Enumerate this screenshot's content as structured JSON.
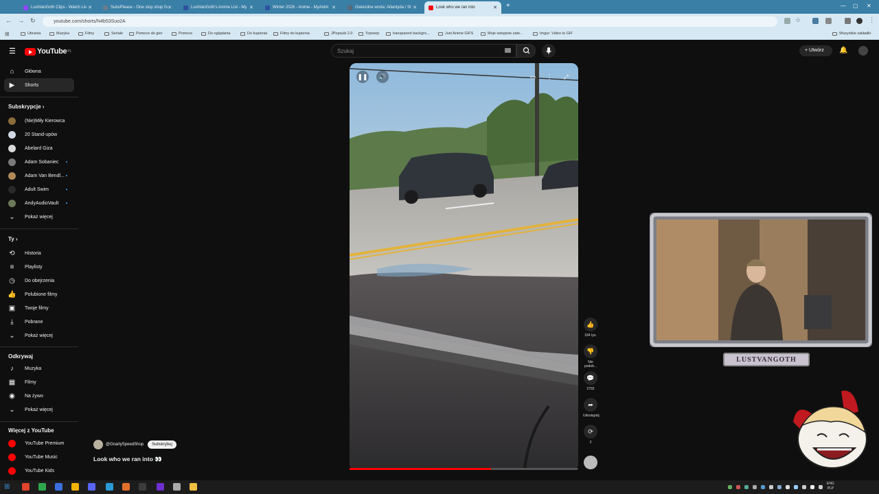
{
  "browser": {
    "tabs": [
      {
        "label": "LustVanGoth Clips - Watch Liv",
        "color": "#9146ff"
      },
      {
        "label": "SubsPlease - One stop shop fo",
        "color": "#6b7c8c"
      },
      {
        "label": "LustVanGoth's Anime List - My",
        "color": "#2e51a2"
      },
      {
        "label": "Winter 2026 - Anime - MyAnim",
        "color": "#2e51a2"
      },
      {
        "label": "Gwiezdne wrota: Atlantyda / St",
        "color": "#5a6a78"
      },
      {
        "label": "Look who we ran into",
        "color": "#ff0000"
      }
    ],
    "new_tab": "+",
    "url": "youtube.com/shorts/N4b53Suo2A",
    "bookmarks": [
      "Ubrania",
      "Muzyka",
      "Filmy",
      "Seriale",
      "Pomoce do gier",
      "Pomoce",
      "Do oglądania",
      "Do kupienia",
      "Filmy do kupienia",
      "JPopsuki 2.0",
      "Trpeeep",
      "transparent backgro...",
      "Just Anime GIFS",
      "Moje wstępnie zate...",
      "Imgur: Video to GIF"
    ],
    "all_bookmarks": "Wszystkie zakładki"
  },
  "youtube": {
    "logo_text": "YouTube",
    "logo_region": "PL",
    "search_placeholder": "Szukaj",
    "create_label": "Utwórz",
    "nav": [
      {
        "label": "Główna",
        "icon": "home-icon"
      },
      {
        "label": "Shorts",
        "icon": "shorts-icon"
      }
    ],
    "subscriptions_header": "Subskrypcje",
    "subscriptions": [
      {
        "label": "(Nie)Miły Kierowca",
        "color": "#8a6d3b",
        "new": false
      },
      {
        "label": "20 Stand-upów",
        "color": "#cfd8e3",
        "new": false
      },
      {
        "label": "Abelard Giza",
        "color": "#d9d9d9",
        "new": false
      },
      {
        "label": "Adam Sobaniec",
        "color": "#7a7a7a",
        "new": true
      },
      {
        "label": "Adam Van Bendl...",
        "color": "#b08a5a",
        "new": true
      },
      {
        "label": "Adult Swim",
        "color": "#2a2a2a",
        "new": true
      },
      {
        "label": "AndyAudioVault",
        "color": "#6c7a5a",
        "new": true
      }
    ],
    "show_more": "Pokaż więcej",
    "you_header": "Ty",
    "you_items": [
      {
        "label": "Historia",
        "icon": "history-icon"
      },
      {
        "label": "Playlisty",
        "icon": "playlist-icon"
      },
      {
        "label": "Do obejrzenia",
        "icon": "watch-later-icon"
      },
      {
        "label": "Polubione filmy",
        "icon": "liked-icon"
      },
      {
        "label": "Twoje filmy",
        "icon": "your-videos-icon"
      },
      {
        "label": "Pobrane",
        "icon": "download-icon"
      },
      {
        "label": "Pokaż więcej",
        "icon": "chevron-down-icon"
      }
    ],
    "explore_header": "Odkrywaj",
    "explore_items": [
      {
        "label": "Muzyka",
        "icon": "music-icon"
      },
      {
        "label": "Filmy",
        "icon": "film-icon"
      },
      {
        "label": "Na żywo",
        "icon": "live-icon"
      },
      {
        "label": "Pokaż więcej",
        "icon": "chevron-down-icon"
      }
    ],
    "more_header": "Więcej z YouTube",
    "more_items": [
      {
        "label": "YouTube Premium",
        "color": "#ff0000"
      },
      {
        "label": "YouTube Music",
        "color": "#ff0000"
      },
      {
        "label": "YouTube Kids",
        "color": "#ff0000"
      }
    ],
    "short": {
      "channel": "@GnarlySpeedShop",
      "subscribe_label": "Subskrybuj",
      "title": "Look who we ran into 👀",
      "progress": 0.62,
      "likes": "184 tys.",
      "dislike_label": "Nie podob...",
      "comments": "2792",
      "share_label": "Udostępnij",
      "remix_count": "2"
    }
  },
  "overlay": {
    "streamer_name": "LUSTVANGOTH"
  },
  "taskbar": {
    "lang": "ENG\nPLP",
    "time": "",
    "date": ""
  }
}
